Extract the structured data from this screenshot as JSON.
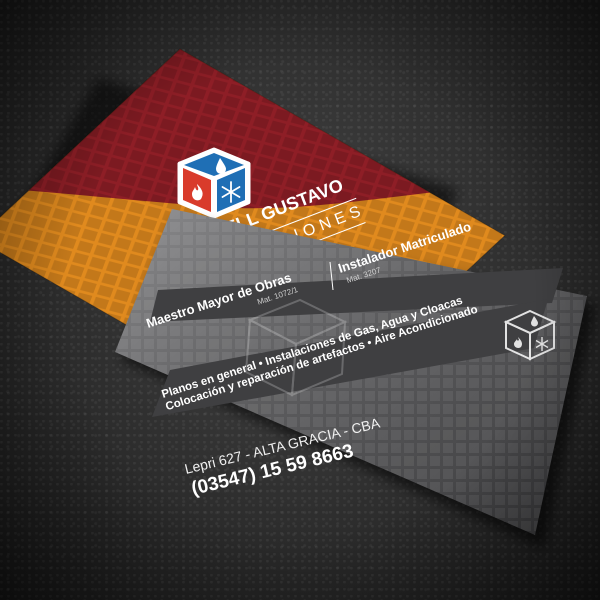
{
  "front_card": {
    "name": "POWELL GUSTAVO",
    "subtitle": "INSTALACIONES",
    "colors": {
      "maroon": "#8e1e26",
      "orange": "#e08a1e",
      "red": "#d93b2b",
      "blue": "#1f6fb5",
      "white": "#ffffff"
    }
  },
  "back_card": {
    "title_left": "Maestro Mayor de Obras",
    "mat_left": "Mat. 1072/1",
    "title_right": "Instalador Matriculado",
    "mat_right": "Mat. 3207",
    "services_line1": "Planos en general  •  Instalaciones de Gas, Agua y Cloacas",
    "services_line2": "Colocación y reparación de artefactos  •  Aire Acondicionado",
    "address": "Lepri 627 - ALTA GRACIA - CBA",
    "phone": "(03547) 15 59 8663",
    "colors": {
      "gray_dark": "#3f3f41",
      "gray_mid": "#6b6b6d",
      "text": "#ffffff"
    }
  }
}
